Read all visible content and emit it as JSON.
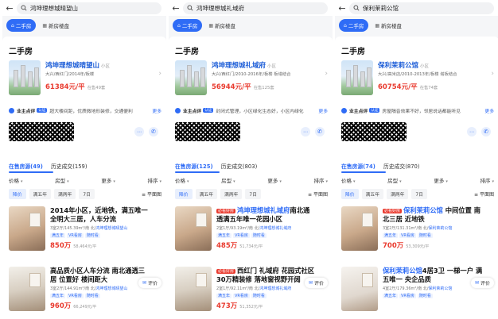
{
  "common": {
    "back_icon": "back-arrow-icon",
    "search_icon": "search-icon",
    "tab_secondhand": "二手房",
    "tab_newhome": "新房楼盘",
    "section_title": "二手房",
    "estate_type": "小区",
    "review_label": "业主点评",
    "review_badge": "认证",
    "review_more": "更多",
    "tab_sold": "历史成交",
    "filters": [
      "价格",
      "房型",
      "更多",
      "排序"
    ],
    "chips": [
      "降价",
      "满五年",
      "满两年",
      "7日"
    ],
    "chip_filter": "平面图",
    "eval_label": "评价",
    "accent_color": "#2f6cf6",
    "price_color": "#e93b2f"
  },
  "panels": [
    {
      "search": "鸿坤理想城晴望山",
      "estate_name": "鸿坤理想城晴望山",
      "estate_meta": "大兴/西红门/2014年/板楼",
      "estate_price": "61384元/平",
      "estate_count": "在售49套",
      "review_text": "超大楼间距，优质微地形装修，交通便利",
      "tab_onsale": "在售房源(49)",
      "tab_sold_count": "(159)",
      "listings": [
        {
          "title1": "2014年小区，近地铁，满五唯一",
          "title2": "全明大三居，人车分流",
          "title1_hl": "",
          "title2_hl": "",
          "tag": "",
          "meta_pre": "3室2厅/145.39m²/南 北/",
          "meta_hl": "鸿坤理想城晴望山",
          "tags": [
            "满五年",
            "VR看房",
            "随时看"
          ],
          "price": "850万",
          "unit": "58,464元/平"
        },
        {
          "title1": "高品质小区人车分流 南北通透三",
          "title2": "居 位置好 楼间距大",
          "title1_hl": "",
          "title2_hl": "",
          "tag": "",
          "meta_pre": "3室2厅/144.91m²/南 北/",
          "meta_hl": "鸿坤理想城晴望山",
          "tags": [
            "满五年",
            "VR看房",
            "随时看"
          ],
          "price": "960万",
          "unit": "66,249元/平"
        }
      ]
    },
    {
      "search": "鸿坤理想城礼域府",
      "estate_name": "鸿坤理想城礼域府",
      "estate_meta": "大兴/西红门/2010-2016年/板楼 板塔结合",
      "estate_price": "56944元/平",
      "estate_count": "在售125套",
      "review_text": "封闭式管理，小区绿化生态好，小区内绿化",
      "tab_onsale": "在售房源(125)",
      "tab_sold_count": "(803)",
      "listings": [
        {
          "title1": "鸿坤理想城礼域府南北通",
          "title2": "透满五年唯一花园小区",
          "title1_hl": "鸿坤理想城礼域府",
          "title2_hl": "",
          "tag": "必看好房",
          "meta_pre": "2室1厅/93.19m²/南 北/",
          "meta_hl": "鸿坤理想城礼域府",
          "tags": [
            "满五年",
            "VR看房",
            "随时看"
          ],
          "price": "485万",
          "unit": "51,734元/平"
        },
        {
          "title1": "西红门 礼域府 花园式社区",
          "title2": "30万精装修 落地窗视野开阔",
          "title1_hl": "礼域府",
          "title2_hl": "",
          "tag": "必看好房",
          "meta_pre": "2室1厅/92.11m²/南 北/",
          "meta_hl": "鸿坤理想城礼域府",
          "tags": [
            "满五年",
            "VR看房",
            "随时看"
          ],
          "price": "473万",
          "unit": "51,352元/平"
        }
      ]
    },
    {
      "search": "保利茉莉公馆",
      "estate_name": "保利茉莉公馆",
      "estate_meta": "大兴/高米店/2010-2013年/板楼 塔板结合",
      "estate_price": "60754元/平",
      "estate_count": "在售74套",
      "review_text": "房屋隔音效果不好，邻居说话都能听见",
      "tab_onsale": "在售房源(74)",
      "tab_sold_count": "(870)",
      "listings": [
        {
          "title1": "保利茉莉公馆 中间位置 南",
          "title2": "北三居 近地铁",
          "title1_hl": "保利茉莉公馆",
          "title2_hl": "",
          "tag": "必看好房",
          "meta_pre": "3室2厅/131.31m²/南 北/",
          "meta_hl": "保利茉莉公馆",
          "tags": [
            "满五年",
            "VR看房",
            "随时看"
          ],
          "price": "700万",
          "unit": "53,309元/平"
        },
        {
          "title1": "保利茉莉公馆4居3卫 一梯一户 满",
          "title2": "五唯一 央企品质",
          "title1_hl": "保利茉莉公馆",
          "title2_hl": "",
          "tag": "",
          "meta_pre": "4室2厅/179.36m²/南 北/",
          "meta_hl": "保利茉莉公馆",
          "tags": [
            "满五年",
            "VR看房",
            "随时看"
          ],
          "price": "",
          "unit": ""
        }
      ]
    }
  ]
}
